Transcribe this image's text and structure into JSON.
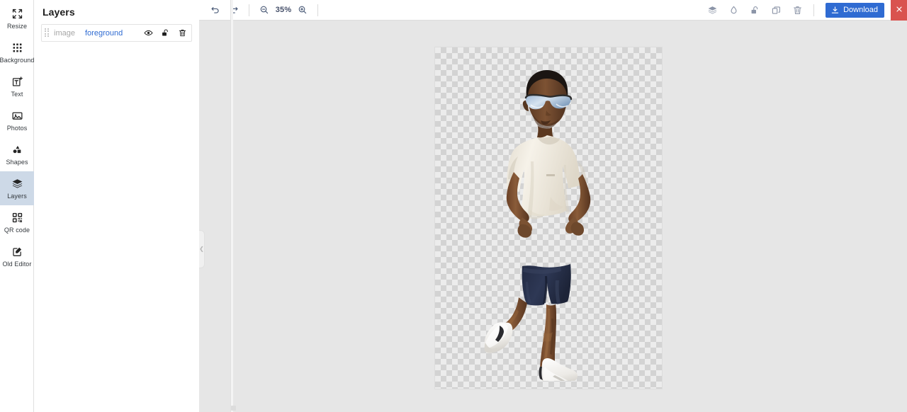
{
  "sidebar": {
    "items": [
      {
        "label": "Resize",
        "icon": "resize-icon",
        "active": false
      },
      {
        "label": "Background",
        "icon": "grid-dots-icon",
        "active": false
      },
      {
        "label": "Text",
        "icon": "text-box-icon",
        "active": false
      },
      {
        "label": "Photos",
        "icon": "photo-icon",
        "active": false
      },
      {
        "label": "Shapes",
        "icon": "shapes-icon",
        "active": false
      },
      {
        "label": "Layers",
        "icon": "layers-stack-icon",
        "active": true
      },
      {
        "label": "QR code",
        "icon": "qr-code-icon",
        "active": false
      },
      {
        "label": "Old Editor",
        "icon": "edit-square-icon",
        "active": false
      }
    ]
  },
  "layers_panel": {
    "title": "Layers",
    "rows": [
      {
        "type": "image",
        "name": "foreground",
        "actions": [
          "eye-visible-icon",
          "unlock-icon",
          "trash-icon"
        ]
      }
    ]
  },
  "toolbar": {
    "undo": "undo-icon",
    "redo": "redo-icon",
    "zoom_out": "zoom-out-icon",
    "zoom_level": "35%",
    "zoom_in": "zoom-in-icon",
    "right_icons": [
      "layers-stack-icon",
      "opacity-droplet-icon",
      "unlock-icon",
      "duplicate-icon",
      "trash-icon"
    ],
    "download_label": "Download",
    "download_icon": "download-icon",
    "close_icon": "close-x-icon"
  },
  "canvas": {
    "collapse_handle_icon": "chevron-left-icon",
    "artwork_alt": "man-running-cutout",
    "transparency_checker": true
  },
  "colors": {
    "accent_blue": "#2f6bd2",
    "close_red": "#d9534f",
    "active_item_bg": "#cdd9e7",
    "stage_bg": "#e6e6e6",
    "checker_light": "#ececec",
    "checker_dark": "#d3d3d3",
    "shirt": "#f3efe6",
    "shorts": "#2b3450",
    "skin": "#6b4429",
    "shoe": "#f5f5f3"
  }
}
